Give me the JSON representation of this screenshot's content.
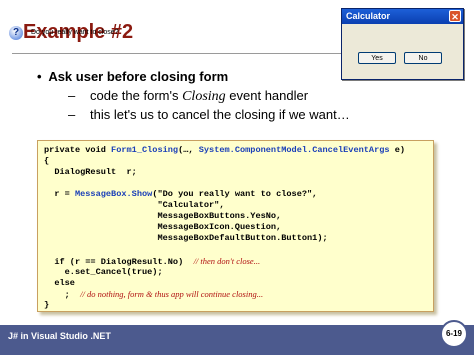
{
  "slide": {
    "title": "Example #2",
    "bullet": "Ask user before closing form",
    "sub1_pre": "code the form's ",
    "sub1_italic": "Closing",
    "sub1_post": " event handler",
    "sub2": "this let's us to cancel the closing if we want…",
    "dash": "–",
    "bullet_mark": "•"
  },
  "dialog": {
    "title": "Calculator",
    "close_symbol": "✕",
    "icon_symbol": "?",
    "message": "Do you really want to close?",
    "yes_label": "Yes",
    "no_label": "No"
  },
  "code": {
    "l1_a": "private void ",
    "l1_b": "Form1_Closing",
    "l1_c": "(…, ",
    "l1_d": "System.ComponentModel.CancelEventArgs",
    "l1_e": " e)",
    "l2": "{",
    "l3": "  DialogResult  r;",
    "l4_a": "  r = ",
    "l4_b": "MessageBox.Show",
    "l4_c": "(\"Do you really want to close?\",",
    "l5": "                      \"Calculator\",",
    "l6": "                      MessageBoxButtons.YesNo,",
    "l7": "                      MessageBoxIcon.Question,",
    "l8": "                      MessageBoxDefaultButton.Button1);",
    "l9_a": "  if (r == DialogResult.No)  ",
    "l9_cmt": "// then don't close...",
    "l10": "    e.set_Cancel(true);",
    "l11": "  else",
    "l12_a": "    ;  ",
    "l12_cmt": "// do nothing, form & thus app will continue closing...",
    "l13": "}"
  },
  "footer": {
    "label": "J# in Visual Studio .NET",
    "page": "6-19"
  }
}
